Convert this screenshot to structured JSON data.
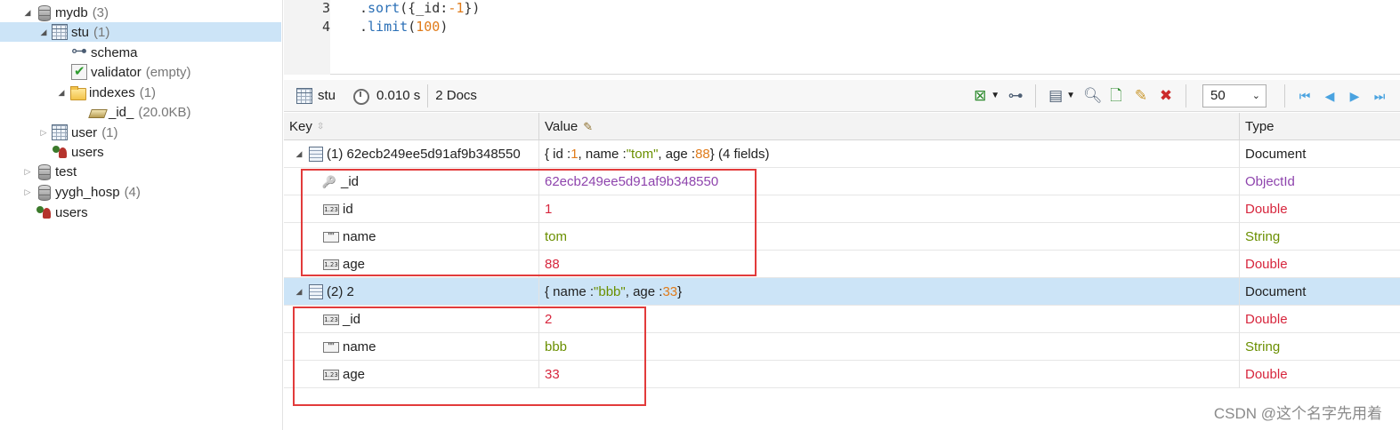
{
  "tree": {
    "mydb": {
      "label": "mydb",
      "count": "(3)"
    },
    "stu": {
      "label": "stu",
      "count": "(1)"
    },
    "schema": {
      "label": "schema"
    },
    "validator": {
      "label": "validator",
      "note": "(empty)"
    },
    "indexes": {
      "label": "indexes",
      "count": "(1)"
    },
    "id_index": {
      "label": "_id_",
      "size": "(20.0KB)"
    },
    "user": {
      "label": "user",
      "count": "(1)"
    },
    "users1": {
      "label": "users"
    },
    "test": {
      "label": "test"
    },
    "yygh": {
      "label": "yygh_hosp",
      "count": "(4)"
    },
    "users2": {
      "label": "users"
    }
  },
  "editor": {
    "line3": {
      "no": "3",
      "dot": ".",
      "fn": "sort",
      "open": "({_id:",
      "num": "-1",
      "close": "})"
    },
    "line4": {
      "no": "4",
      "dot": ".",
      "fn": "limit",
      "open": "(",
      "num": "100",
      "close": ")"
    }
  },
  "toolbar": {
    "collection": "stu",
    "time": "0.010 s",
    "docs": "2 Docs",
    "page_size": "50",
    "icons": [
      "table-icon",
      "clock-icon",
      "export-icon",
      "tree-view-icon",
      "view-icon",
      "find-icon",
      "add-doc-icon",
      "edit-doc-icon",
      "delete-doc-icon",
      "first-page-icon",
      "prev-page-icon",
      "next-page-icon",
      "last-page-icon"
    ]
  },
  "grid": {
    "headers": {
      "key": "Key",
      "value": "Value",
      "type": "Type"
    },
    "doc1": {
      "key": "(1) 62ecb249ee5d91af9b348550",
      "summary_a": "{ id : ",
      "summary_a_num": "1",
      "summary_b": ", name : ",
      "summary_b_str": "\"tom\"",
      "summary_c": ", age : ",
      "summary_c_num": "88",
      "summary_d": " } (4 fields)",
      "type": "Document",
      "fields": [
        {
          "key": "_id",
          "value": "62ecb249ee5d91af9b348550",
          "type": "ObjectId"
        },
        {
          "key": "id",
          "value": "1",
          "type": "Double"
        },
        {
          "key": "name",
          "value": "tom",
          "type": "String"
        },
        {
          "key": "age",
          "value": "88",
          "type": "Double"
        }
      ]
    },
    "doc2": {
      "key": "(2) 2",
      "summary_a": "{ name : ",
      "summary_a_str": "\"bbb\"",
      "summary_b": ", age : ",
      "summary_b_num": "33",
      "summary_c": " }",
      "type": "Document",
      "fields": [
        {
          "key": "_id",
          "value": "2",
          "type": "Double"
        },
        {
          "key": "name",
          "value": "bbb",
          "type": "String"
        },
        {
          "key": "age",
          "value": "33",
          "type": "Double"
        }
      ]
    }
  },
  "colors": {
    "accent_selection": "#cce4f7",
    "annotation_red": "#e23b3b"
  },
  "watermark": "CSDN @这个名字先用着"
}
